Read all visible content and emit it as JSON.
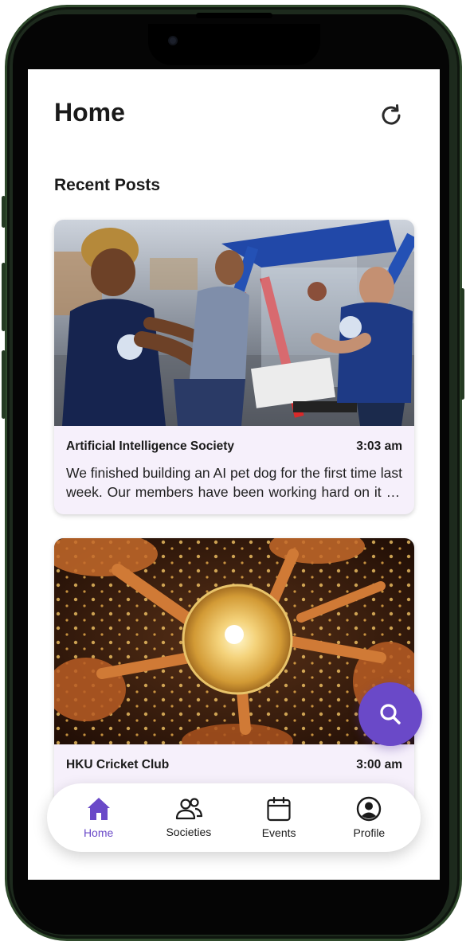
{
  "header": {
    "title": "Home",
    "refresh_icon": "refresh-icon"
  },
  "section": {
    "title": "Recent Posts"
  },
  "posts": [
    {
      "society": "Artificial Intelligence Society",
      "time": "3:03 am",
      "excerpt": "We finished building an AI pet dog for the first time last week. Our members have been working hard on it for months and we are so proud of the result."
    },
    {
      "society": "HKU Cricket Club",
      "time": "3:00 am",
      "excerpt": ""
    }
  ],
  "fab": {
    "icon": "search-icon"
  },
  "tabs": [
    {
      "label": "Home",
      "icon": "home-icon",
      "active": true
    },
    {
      "label": "Societies",
      "icon": "people-icon",
      "active": false
    },
    {
      "label": "Events",
      "icon": "calendar-icon",
      "active": false
    },
    {
      "label": "Profile",
      "icon": "profile-icon",
      "active": false
    }
  ],
  "colors": {
    "accent": "#6a49c8",
    "card_bg": "#f6f0fb",
    "text": "#1a1a1a"
  }
}
